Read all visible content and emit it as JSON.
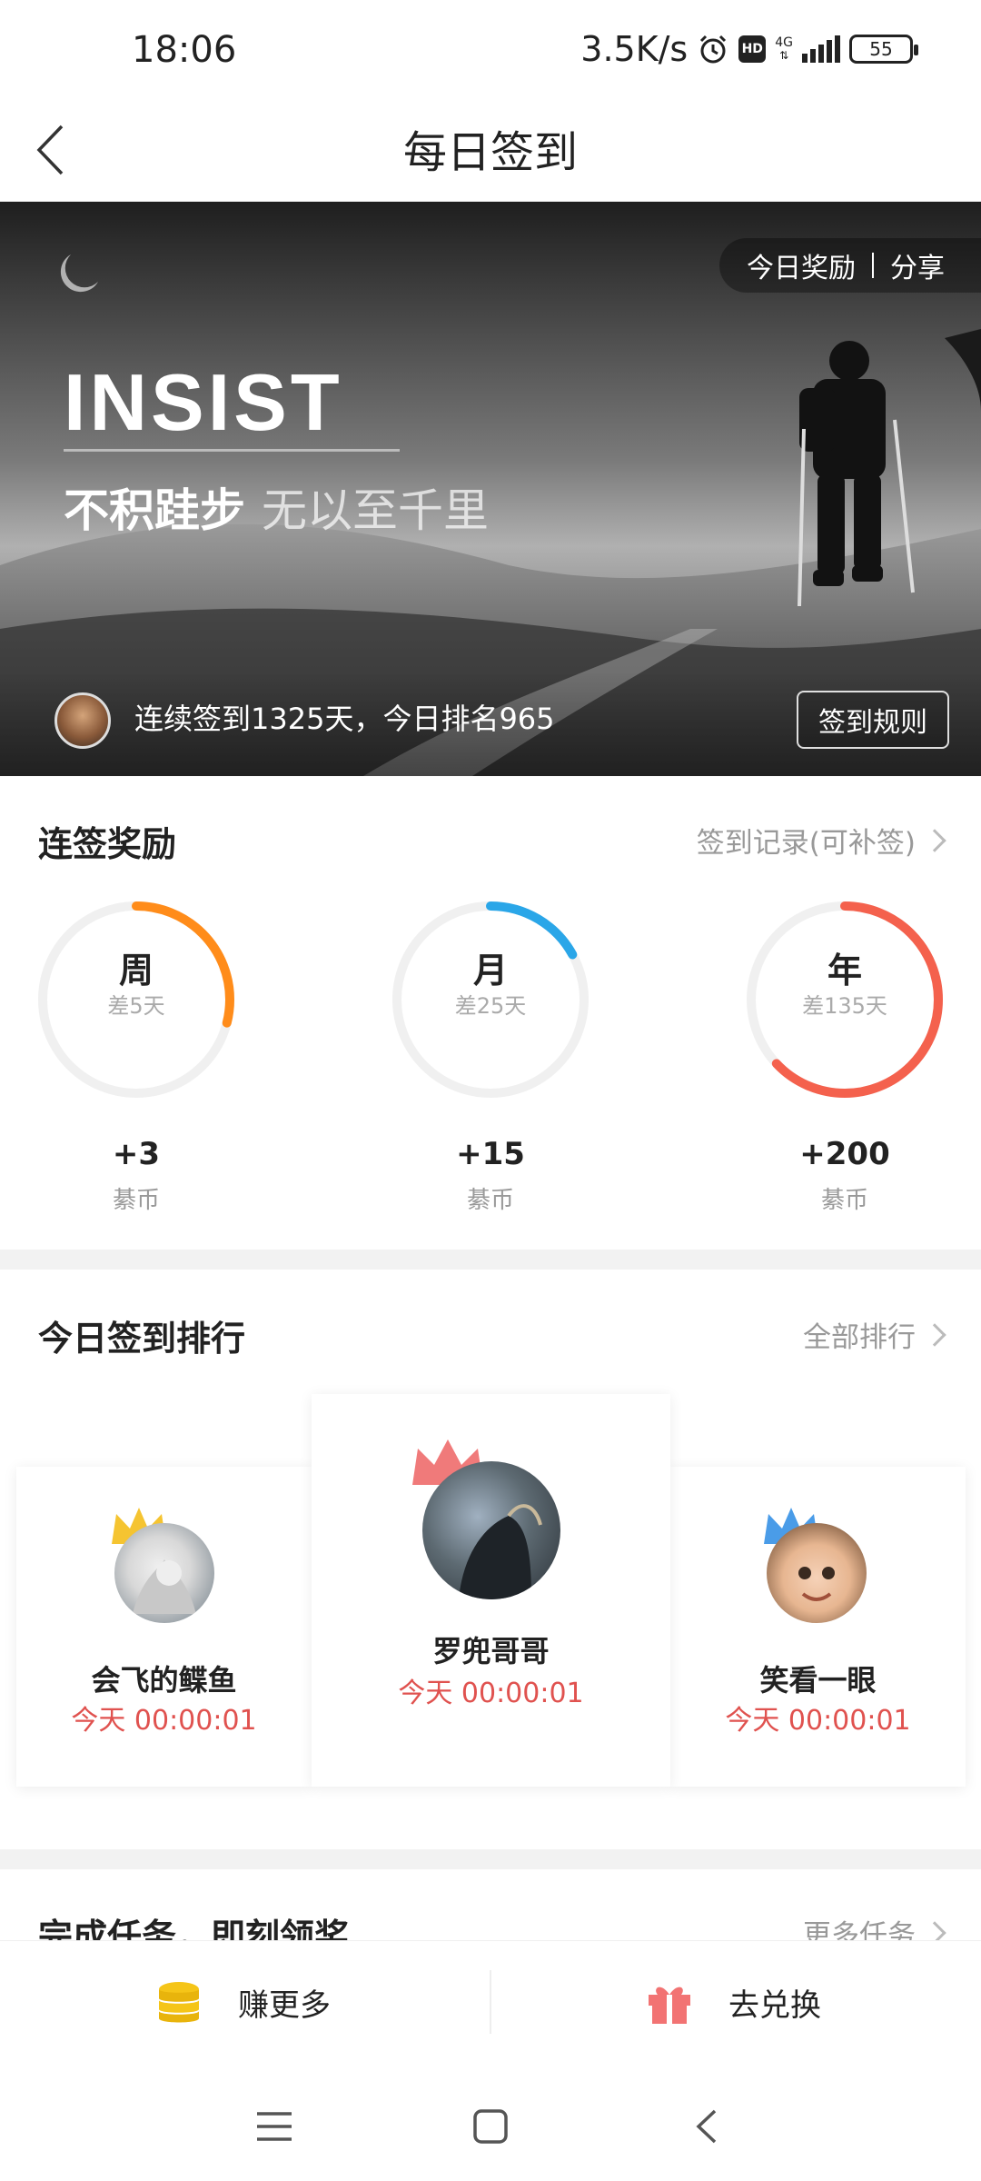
{
  "status_bar": {
    "time": "18:06",
    "net_speed": "3.5K/s",
    "hd_badge": "HD",
    "network_type": "4G",
    "battery_level": "55"
  },
  "nav": {
    "title": "每日签到",
    "back_icon": "back-arrow-icon"
  },
  "banner": {
    "reward_link": "今日奖励",
    "share_link": "分享",
    "headline": "INSIST",
    "slogan_main": "不积跬步",
    "slogan_sub": "无以至千里",
    "streak_text": "连续签到1325天，今日排名965",
    "rules_button": "签到规则"
  },
  "streak_rewards": {
    "title": "连签奖励",
    "record_link": "签到记录(可补签)",
    "items": [
      {
        "label": "周",
        "remaining": "差5天",
        "reward": "+3",
        "unit": "綦币",
        "progress": 0.29,
        "color": "#ff8c1a"
      },
      {
        "label": "月",
        "remaining": "差25天",
        "reward": "+15",
        "unit": "綦币",
        "progress": 0.17,
        "color": "#2aa6e8"
      },
      {
        "label": "年",
        "remaining": "差135天",
        "reward": "+200",
        "unit": "綦币",
        "progress": 0.63,
        "color": "#f4614d"
      }
    ]
  },
  "ranking": {
    "title": "今日签到排行",
    "all_link": "全部排行",
    "top": [
      {
        "rank": 2,
        "name": "会飞的鲽鱼",
        "time": "今天 00:00:01",
        "crown_color": "#f5c431"
      },
      {
        "rank": 1,
        "name": "罗兜哥哥",
        "time": "今天 00:00:01",
        "crown_color": "#f07a7a"
      },
      {
        "rank": 3,
        "name": "笑看一眼",
        "time": "今天 00:00:01",
        "crown_color": "#4a9ce8"
      }
    ]
  },
  "tasks": {
    "title": "完成任务，即刻领奖",
    "more_link": "更多任务"
  },
  "bottom_bar": {
    "earn_label": "赚更多",
    "exchange_label": "去兑换",
    "earn_icon": "coins-icon",
    "exchange_icon": "gift-icon"
  },
  "colors": {
    "accent_red": "#e0524f",
    "week_ring": "#ff8c1a",
    "month_ring": "#2aa6e8",
    "year_ring": "#f4614d"
  }
}
